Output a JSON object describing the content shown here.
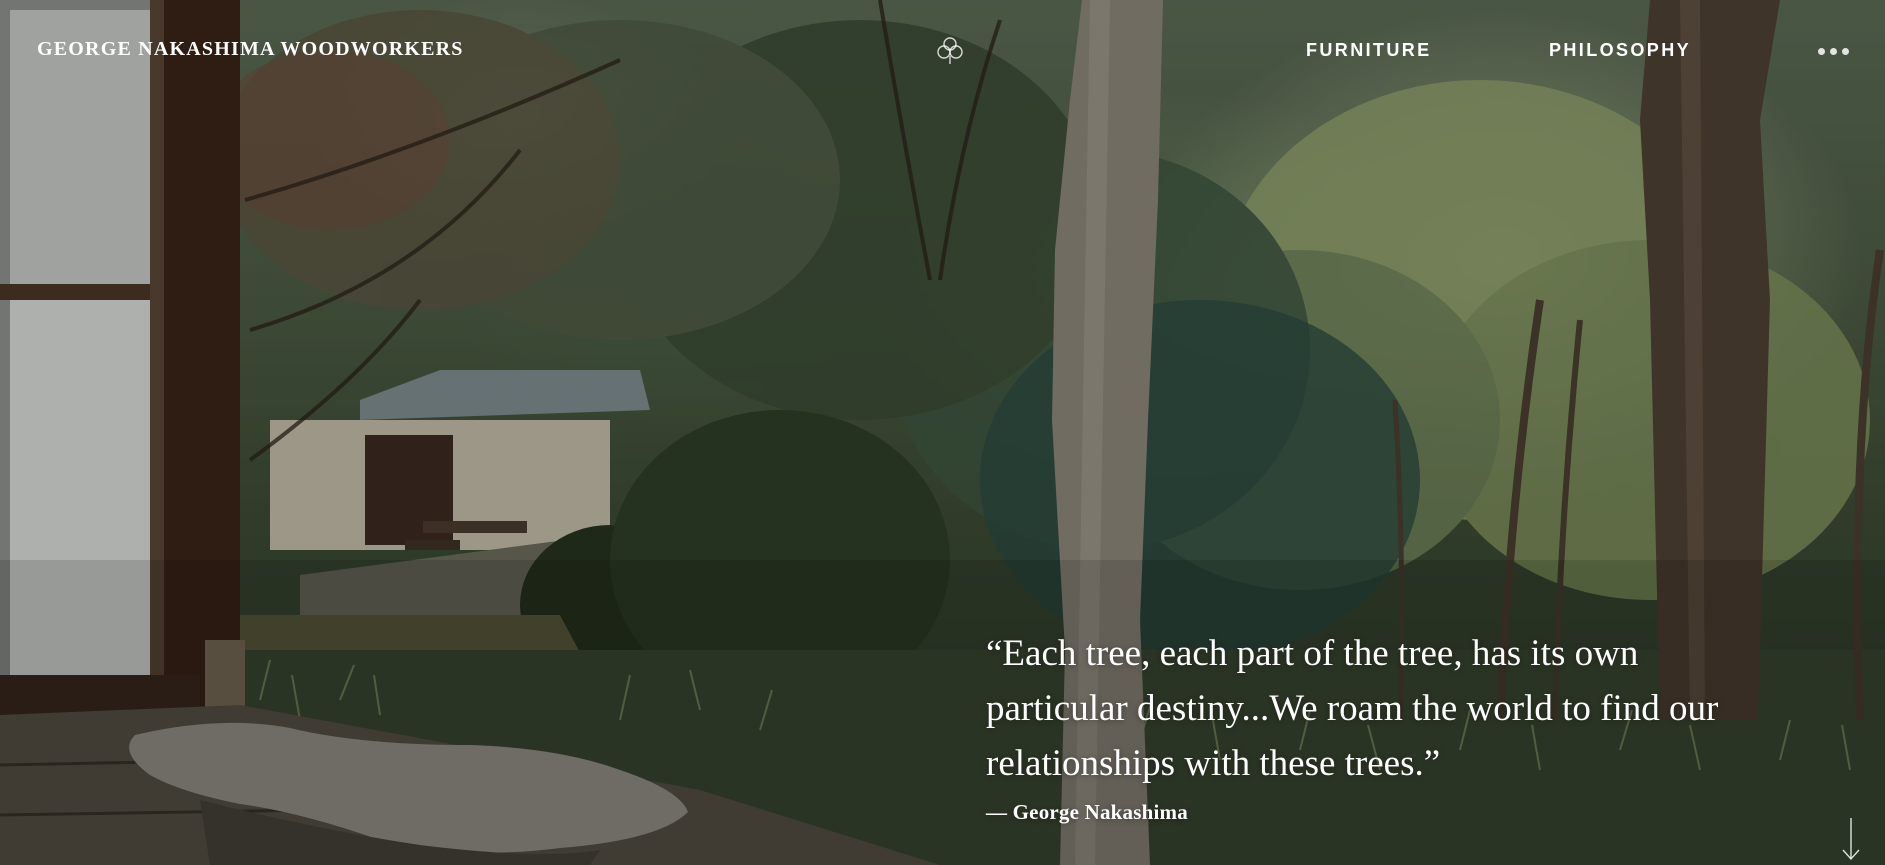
{
  "site": {
    "logo_text": "GEORGE NAKASHIMA WOODWORKERS",
    "emblem_icon": "leaf-cluster-emblem-icon"
  },
  "nav": {
    "items": [
      {
        "label": "FURNITURE"
      },
      {
        "label": "PHILOSOPHY"
      }
    ],
    "more_icon": "more-dots-icon"
  },
  "hero": {
    "quote": "“Each tree, each part of the tree, has its own particular destiny...We roam the world to find our relationships with these trees.”",
    "attribution": "— George Nakashima",
    "scroll_icon": "arrow-down-icon"
  },
  "colors": {
    "text": "#ffffff",
    "foliage_dark": "#2f3a2a",
    "foliage_light": "#9fb07a",
    "wood_dark": "#3a2418",
    "trunk": "#6b6358"
  }
}
